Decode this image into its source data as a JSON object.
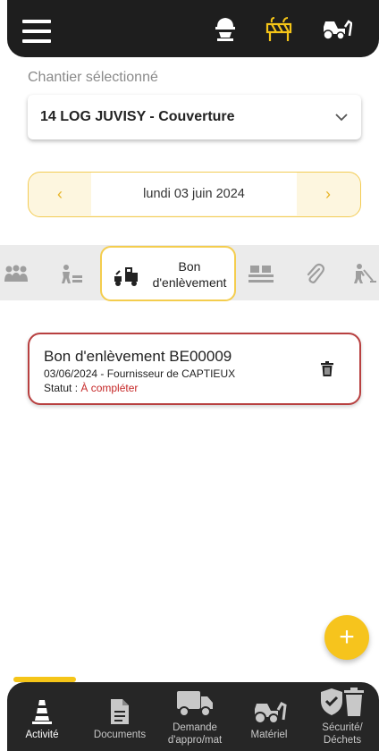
{
  "header": {
    "menu_icon": "hamburger-menu-icon",
    "icons": [
      "worker-helmet-icon",
      "construction-barrier-icon",
      "tractor-icon"
    ],
    "accent": "#f5c518"
  },
  "site": {
    "label": "Chantier sélectionné",
    "value": "14 LOG JUVISY - Couverture"
  },
  "date": {
    "value": "lundi 03 juin 2024"
  },
  "categories": {
    "active_label_1": "Bon",
    "active_label_2": "d'enlèvement",
    "icons": [
      "team-icon",
      "workers-icon",
      "pickup-truck-icon",
      "pallet-icon",
      "attachment-icon",
      "digging-worker-icon"
    ]
  },
  "card": {
    "title": "Bon d'enlèvement BE00009",
    "subtitle": "03/06/2024 - Fournisseur de CAPTIEUX",
    "status_label": "Statut :",
    "status_value": "À compléter",
    "status_color": "#c62828",
    "border_color": "#b84040"
  },
  "fab": {
    "label": "+"
  },
  "bottom_nav": [
    {
      "label": "Activité",
      "icon": "cone-icon",
      "active": true
    },
    {
      "label": "Documents",
      "icon": "document-icon",
      "active": false
    },
    {
      "label": "Demande d'appro/mat",
      "line1": "Demande",
      "line2": "d'appro/mat",
      "icon": "truck-icon",
      "active": false
    },
    {
      "label": "Matériel",
      "icon": "tractor-icon",
      "active": false
    },
    {
      "label": "Sécurité/ Déchets",
      "line1": "Sécurité/",
      "line2": "Déchets",
      "icon": "shield-trash-icon",
      "active": false
    }
  ]
}
